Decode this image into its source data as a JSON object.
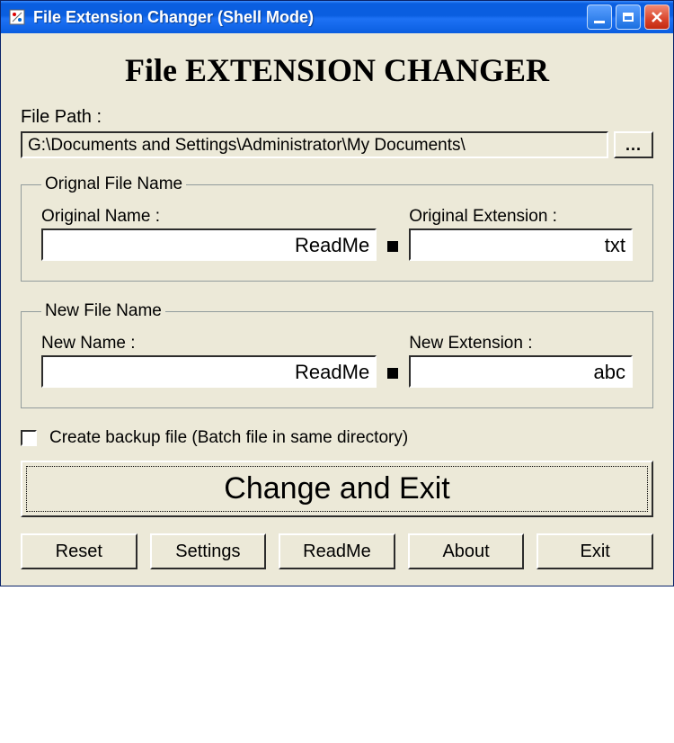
{
  "window": {
    "title": "File Extension Changer (Shell Mode)"
  },
  "heading": "File EXTENSION CHANGER",
  "file_path_label": "File Path :",
  "file_path_value": "G:\\Documents and Settings\\Administrator\\My Documents\\",
  "browse_label": "...",
  "original_group": {
    "legend": "Orignal File Name",
    "name_label": "Original Name :",
    "name_value": "ReadMe",
    "ext_label": "Original Extension :",
    "ext_value": "txt"
  },
  "new_group": {
    "legend": "New File Name",
    "name_label": "New Name :",
    "name_value": "ReadMe",
    "ext_label": "New Extension :",
    "ext_value": "abc"
  },
  "backup_checkbox": {
    "checked": false,
    "label": "Create backup file (Batch file in same directory)"
  },
  "main_button": "Change and Exit",
  "buttons": {
    "reset": "Reset",
    "settings": "Settings",
    "readme": "ReadMe",
    "about": "About",
    "exit": "Exit"
  }
}
